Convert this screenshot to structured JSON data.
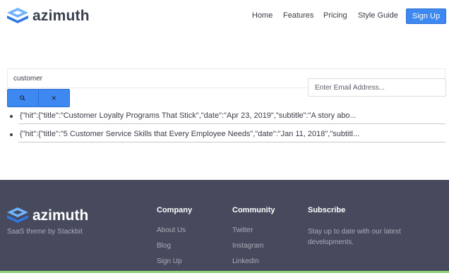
{
  "brand": {
    "name": "azimuth",
    "accent": "#3d88f1",
    "logo_light": "#6fb3ff",
    "logo_dark": "#2f78e0"
  },
  "nav": {
    "items": [
      "Home",
      "Features",
      "Pricing",
      "Style Guide"
    ],
    "signup_label": "Sign Up"
  },
  "search": {
    "value": "customer",
    "search_icon": "search-icon",
    "close_icon": "close-icon",
    "close_glyph": "×"
  },
  "results": [
    "{\"hit\":{\"title\":\"Customer Loyalty Programs That Stick\",\"date\":\"Apr 23, 2019\",\"subtitle\":\"A story abo...",
    "{\"hit\":{\"title\":\"5 Customer Service Skills that Every Employee Needs\",\"date\":\"Jan 11, 2018\",\"subtitl..."
  ],
  "footer": {
    "brand": "azimuth",
    "tagline": "SaaS theme by Stackbit",
    "company": {
      "heading": "Company",
      "links": [
        "About Us",
        "Blog",
        "Sign Up"
      ]
    },
    "community": {
      "heading": "Community",
      "links": [
        "Twitter",
        "Instagram",
        "LinkedIn"
      ]
    },
    "subscribe": {
      "heading": "Subscribe",
      "text": "Stay up to date with our latest developments.",
      "email_placeholder": "Enter Email Address..."
    },
    "background": "#464a5c"
  }
}
